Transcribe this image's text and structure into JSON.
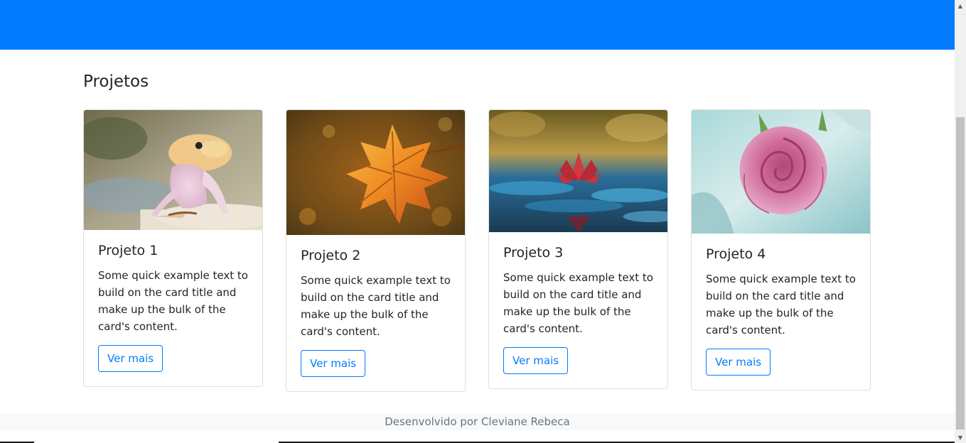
{
  "section": {
    "title": "Projetos"
  },
  "cards": [
    {
      "title": "Projeto 1",
      "text": "Some quick example text to build on the card title and make up the bulk of the card's content.",
      "button": "Ver mais",
      "image": "gecko-photo"
    },
    {
      "title": "Projeto 2",
      "text": "Some quick example text to build on the card title and make up the bulk of the card's content.",
      "button": "Ver mais",
      "image": "autumn-leaf-photo"
    },
    {
      "title": "Projeto 3",
      "text": "Some quick example text to build on the card title and make up the bulk of the card's content.",
      "button": "Ver mais",
      "image": "water-lily-photo"
    },
    {
      "title": "Projeto 4",
      "text": "Some quick example text to build on the card title and make up the bulk of the card's content.",
      "button": "Ver mais",
      "image": "pink-rose-photo"
    }
  ],
  "footer": {
    "text": "Desenvolvido por Cleviane Rebeca"
  },
  "colors": {
    "navbar": "#007bff",
    "primary": "#007bff",
    "footer_bg": "#f8f9fa",
    "muted": "#6c757d"
  }
}
